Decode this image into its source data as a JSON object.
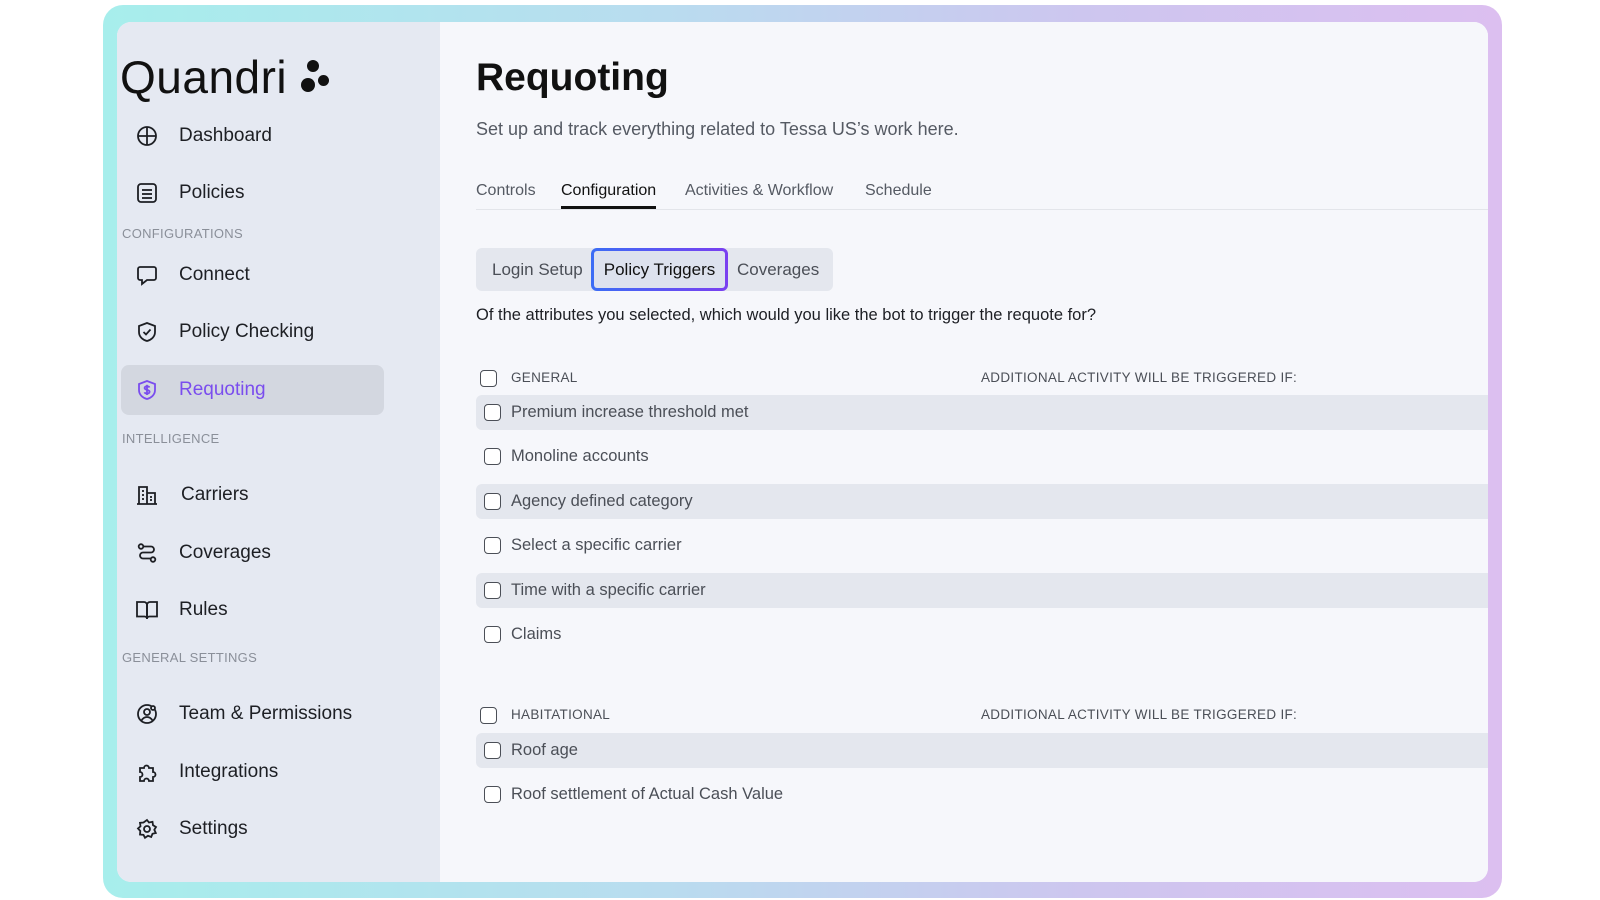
{
  "brand": {
    "name": "Quandri"
  },
  "sidebar": {
    "items": [
      {
        "label": "Dashboard",
        "icon": "dashboard-icon"
      },
      {
        "label": "Policies",
        "icon": "policies-icon"
      },
      {
        "label": "Connect",
        "icon": "chat-icon"
      },
      {
        "label": "Policy Checking",
        "icon": "shield-check-icon"
      },
      {
        "label": "Requoting",
        "icon": "shield-dollar-icon",
        "active": true
      },
      {
        "label": "Carriers",
        "icon": "building-icon"
      },
      {
        "label": "Coverages",
        "icon": "route-icon"
      },
      {
        "label": "Rules",
        "icon": "book-icon"
      },
      {
        "label": "Team & Permissions",
        "icon": "user-gear-icon"
      },
      {
        "label": "Integrations",
        "icon": "puzzle-icon"
      },
      {
        "label": "Settings",
        "icon": "gear-icon"
      }
    ],
    "sections": {
      "configurations": "CONFIGURATIONS",
      "intelligence": "INTELLIGENCE",
      "general_settings": "GENERAL SETTINGS"
    }
  },
  "main": {
    "title": "Requoting",
    "subtitle": "Set up and track everything related to Tessa US’s work here.",
    "tabs": [
      "Controls",
      "Configuration",
      "Activities & Workflow",
      "Schedule"
    ],
    "active_tab": "Configuration",
    "subtabs": [
      "Login Setup",
      "Policy Triggers",
      "Coverages"
    ],
    "active_subtab": "Policy Triggers",
    "question": "Of the attributes you selected, which would you like the bot to trigger the requote for?",
    "groups": [
      {
        "name": "GENERAL",
        "additional": "ADDITIONAL ACTIVITY WILL BE TRIGGERED IF:",
        "items": [
          "Premium increase threshold met",
          "Monoline accounts",
          "Agency defined category",
          "Select a specific carrier",
          "Time with a specific carrier",
          "Claims"
        ]
      },
      {
        "name": "HABITATIONAL",
        "additional": "ADDITIONAL ACTIVITY WILL BE TRIGGERED IF:",
        "items": [
          "Roof age",
          "Roof settlement of Actual Cash Value"
        ]
      }
    ]
  },
  "colors": {
    "accent": "#7a4dee",
    "gradient_start": "#3b6df5",
    "gradient_end": "#7a3ff0"
  }
}
